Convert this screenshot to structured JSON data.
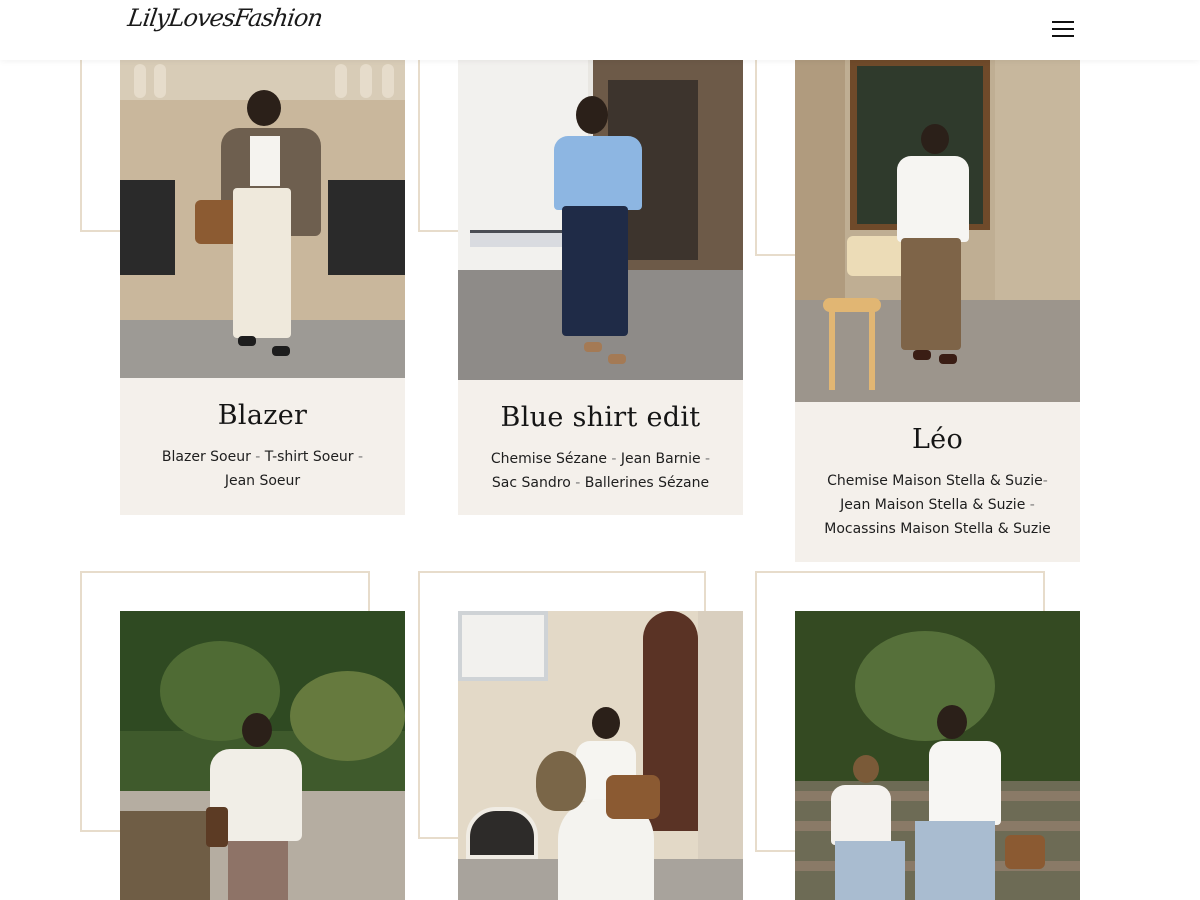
{
  "header": {
    "logo_text": "LilyLovesFashion",
    "menu_icon": "hamburger-menu-icon"
  },
  "looks": [
    {
      "title": "Blazer",
      "items": [
        {
          "label": "Blazer Soeur",
          "sep": " - "
        },
        {
          "label": "T-shirt Soeur",
          "sep": " - "
        },
        {
          "label": "Jean Soeur",
          "sep": ""
        }
      ]
    },
    {
      "title": "Blue shirt edit",
      "items": [
        {
          "label": "Chemise Sézane",
          "sep": " - "
        },
        {
          "label": "Jean Barnie",
          "sep": " - "
        },
        {
          "label": "Sac Sandro",
          "sep": " - "
        },
        {
          "label": "Ballerines Sézane",
          "sep": ""
        }
      ]
    },
    {
      "title": "Léo",
      "items": [
        {
          "label": "Chemise Maison Stella & Suzie",
          "sep": "- "
        },
        {
          "label": "Jean Maison Stella & Suzie",
          "sep": " -"
        },
        {
          "label": "Mocassins Maison Stella & Suzie",
          "sep": ""
        }
      ]
    }
  ],
  "colors": {
    "caption_bg": "#f4f0eb",
    "frame": "#e7dccb",
    "text": "#1e1e1e"
  }
}
